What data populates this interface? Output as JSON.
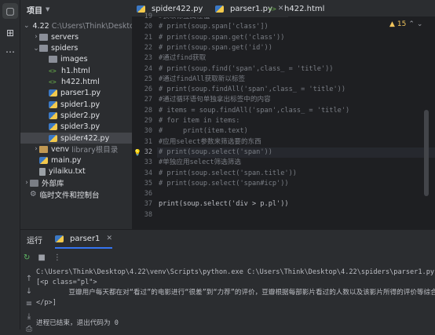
{
  "sidebar_tools": [
    "folder-icon",
    "structure-icon",
    "more-icon"
  ],
  "project": {
    "title": "项目",
    "items": [
      {
        "label": "4.22",
        "path": "C:\\Users\\Think\\Desktop",
        "type": "folder",
        "indent": 0,
        "expanded": true
      },
      {
        "label": "servers",
        "type": "folder",
        "indent": 1,
        "expanded": false
      },
      {
        "label": "spiders",
        "type": "folder",
        "indent": 1,
        "expanded": true
      },
      {
        "label": "images",
        "type": "folder",
        "indent": 2
      },
      {
        "label": "h1.html",
        "type": "html",
        "indent": 2
      },
      {
        "label": "h422.html",
        "type": "html",
        "indent": 2
      },
      {
        "label": "parser1.py",
        "type": "py",
        "indent": 2
      },
      {
        "label": "spider1.py",
        "type": "py",
        "indent": 2
      },
      {
        "label": "spider2.py",
        "type": "py",
        "indent": 2
      },
      {
        "label": "spider3.py",
        "type": "py",
        "indent": 2
      },
      {
        "label": "spider422.py",
        "type": "py",
        "indent": 2,
        "selected": true
      },
      {
        "label": "venv",
        "suffix": "library根目录",
        "type": "venv",
        "indent": 1,
        "expanded": false
      },
      {
        "label": "main.py",
        "type": "py",
        "indent": 1
      },
      {
        "label": "yilaiku.txt",
        "type": "txt",
        "indent": 1
      },
      {
        "label": "外部库",
        "type": "lib",
        "indent": 0,
        "expanded": false
      },
      {
        "label": "临时文件和控制台",
        "type": "scratch",
        "indent": 0
      }
    ]
  },
  "editor": {
    "tabs": [
      {
        "label": "spider422.py",
        "type": "py",
        "active": false
      },
      {
        "label": "parser1.py",
        "type": "py",
        "active": true
      },
      {
        "label": "h422.html",
        "type": "html",
        "active": false
      }
    ],
    "warnings": "15",
    "first_line": 19,
    "current_line": 32,
    "lines": [
      {
        "n": "19",
        "text": "#获取标签属性值",
        "kind": "comment"
      },
      {
        "n": "20",
        "text": "# print(soup.span['class'])",
        "kind": "comment"
      },
      {
        "n": "21",
        "text": "# print(soup.span.get('class'))",
        "kind": "comment"
      },
      {
        "n": "22",
        "text": "# print(soup.span.get('id'))",
        "kind": "comment"
      },
      {
        "n": "23",
        "text": "#通过find获取",
        "kind": "comment"
      },
      {
        "n": "24",
        "text": "# print(soup.find('span',class_ = 'title'))",
        "kind": "comment"
      },
      {
        "n": "25",
        "text": "#通过findAll获取新以标签",
        "kind": "comment"
      },
      {
        "n": "26",
        "text": "# print(soup.findAll('span',class_ = 'title'))",
        "kind": "comment"
      },
      {
        "n": "27",
        "text": "#通过循环语句单独拿出标签中的内容",
        "kind": "comment"
      },
      {
        "n": "28",
        "text": "# items = soup.findAll('span',class_ = 'title')",
        "kind": "comment"
      },
      {
        "n": "29",
        "text": "# for item in items:",
        "kind": "comment"
      },
      {
        "n": "30",
        "text": "#     print(item.text)",
        "kind": "comment"
      },
      {
        "n": "31",
        "text": "#应用select参数来筛选要的东西",
        "kind": "comment"
      },
      {
        "n": "32",
        "text": "# print(soup.select('span'))",
        "kind": "comment"
      },
      {
        "n": "33",
        "text": "#单独应用select筛选筛选",
        "kind": "comment"
      },
      {
        "n": "34",
        "text": "# print(soup.select('span.title'))",
        "kind": "comment"
      },
      {
        "n": "35",
        "text": "# print(soup.select('span#icp'))",
        "kind": "comment"
      },
      {
        "n": "36",
        "text": "",
        "kind": "comment"
      },
      {
        "n": "37",
        "text": "print(soup.select('div > p.pl'))",
        "kind": "code"
      },
      {
        "n": "38",
        "text": "",
        "kind": "comment"
      }
    ]
  },
  "run": {
    "tab_label": "运行",
    "config": "parser1",
    "output": [
      "C:\\Users\\Think\\Desktop\\4.22\\venv\\Scripts\\python.exe C:\\Users\\Think\\Desktop\\4.22\\spiders\\parser1.py",
      "[<p class=\"pl\">",
      "        豆瓣用户每天都在对“看过”的电影进行“很差”到“力荐”的评价，豆瓣根据每部影片看过的人数以及该影片所得的评价等综合数据，通过算法",
      "</p>]",
      "",
      "进程已结束，退出代码为 0"
    ]
  }
}
